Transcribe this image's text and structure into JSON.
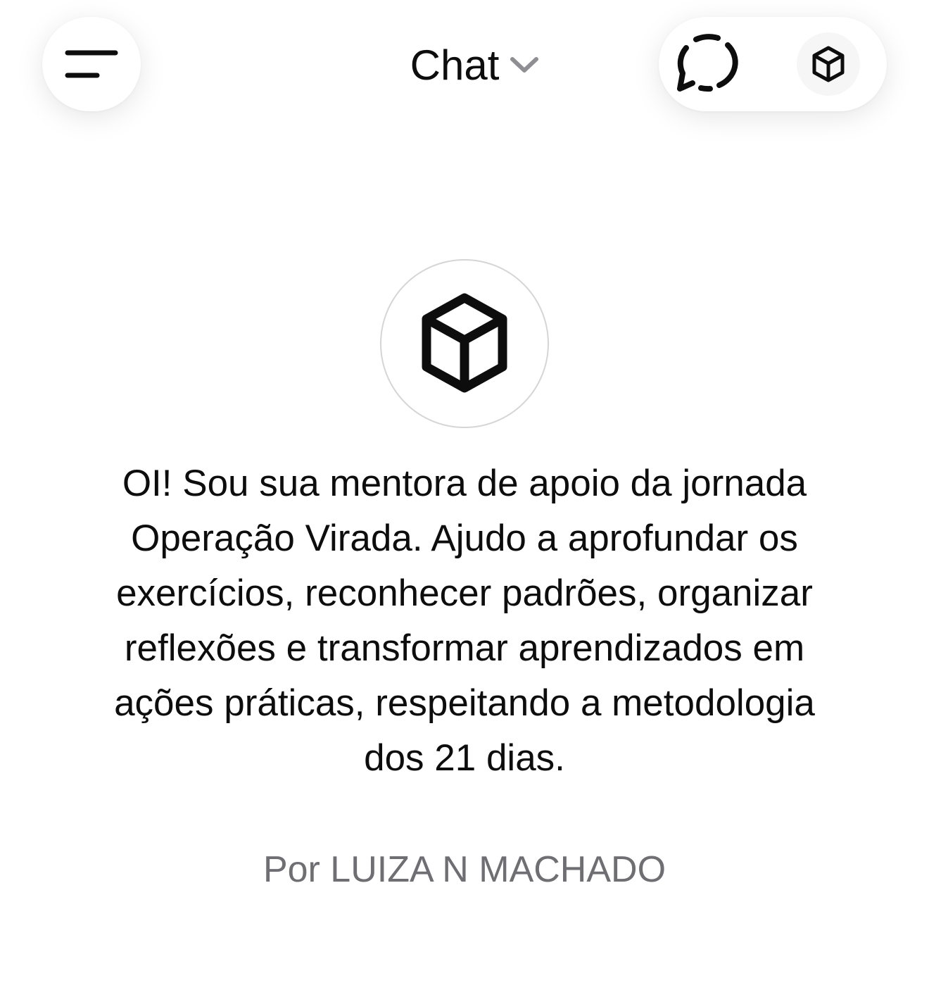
{
  "header": {
    "title": "Chat",
    "menu_icon": "hamburger-menu-icon",
    "dropdown_icon": "chevron-down-icon",
    "new_chat_icon": "speech-bubble-icon",
    "gpt_icon": "cube-icon"
  },
  "gpt": {
    "avatar_icon": "cube-icon",
    "description": "OI! Sou sua mentora de apoio da jornada Operação Virada. Ajudo a aprofundar os exercícios, reconhecer padrões, organizar reflexões e transformar aprendizados em ações práticas, respeitando a metodologia dos 21 dias.",
    "author": "Por LUIZA N MACHADO"
  },
  "colors": {
    "text": "#0d0d0d",
    "muted_text": "#6e6e73",
    "chevron": "#8e8e93",
    "border": "#d5d5d5"
  }
}
